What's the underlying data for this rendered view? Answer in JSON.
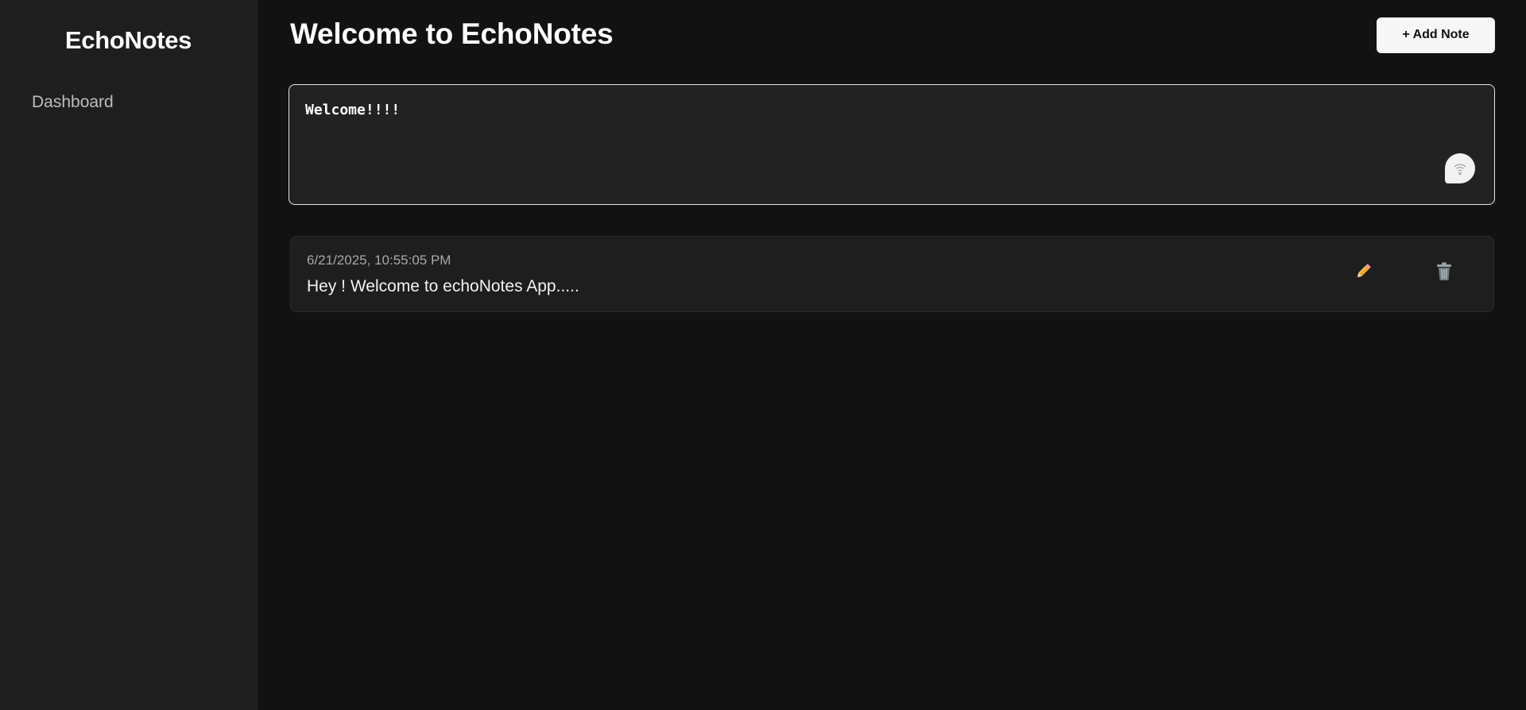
{
  "sidebar": {
    "brand": "EchoNotes",
    "items": [
      {
        "label": "Dashboard"
      }
    ]
  },
  "header": {
    "title": "Welcome to EchoNotes",
    "add_note_label": "+ Add Note"
  },
  "editor": {
    "value": "Welcome!!!!",
    "mic_icon": "microphone-off-icon"
  },
  "notes": [
    {
      "timestamp": "6/21/2025, 10:55:05 PM",
      "text": "Hey ! Welcome to echoNotes App.....",
      "edit_icon": "pencil-icon",
      "delete_icon": "trash-icon"
    }
  ],
  "colors": {
    "background": "#121212",
    "sidebar": "#1e1e1e",
    "card": "#1e1e1e",
    "editor": "#222222",
    "accent_pencil": "#f5a623"
  }
}
